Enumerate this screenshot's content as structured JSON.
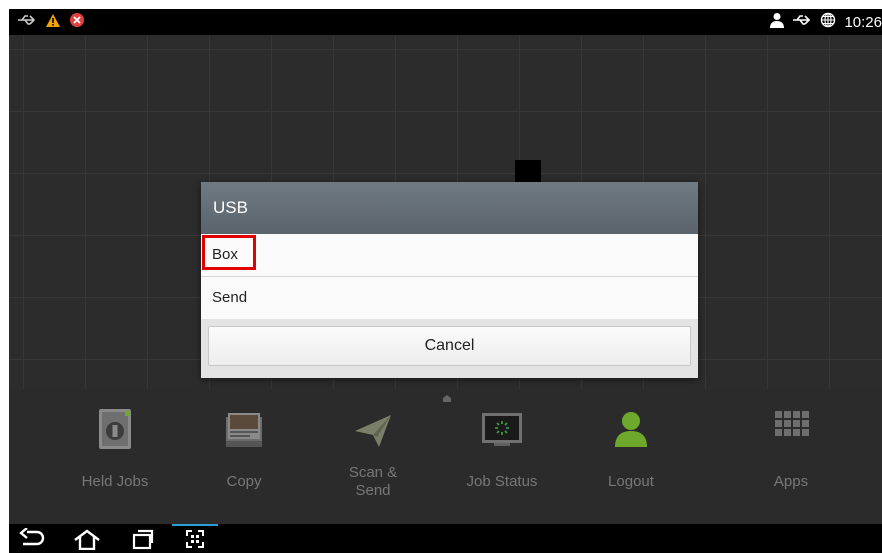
{
  "status_bar": {
    "time": "10:26",
    "left_icons": [
      "usb-icon",
      "warning-icon",
      "error-icon"
    ],
    "right_icons": [
      "user-icon",
      "usb-icon",
      "globe-icon"
    ]
  },
  "dialog": {
    "title": "USB",
    "options": [
      {
        "label": "Box",
        "highlighted": true
      },
      {
        "label": "Send",
        "highlighted": false
      }
    ],
    "cancel_label": "Cancel"
  },
  "dock": {
    "items": [
      {
        "label": "Held Jobs",
        "icon": "held-jobs-icon"
      },
      {
        "label": "Copy",
        "icon": "copy-icon"
      },
      {
        "label": "Scan &\nSend",
        "icon": "scan-send-icon"
      },
      {
        "label": "Job Status",
        "icon": "job-status-icon"
      },
      {
        "label": "Logout",
        "icon": "logout-icon"
      },
      {
        "label": "Apps",
        "icon": "apps-icon"
      }
    ]
  },
  "nav_bar": {
    "buttons": [
      "back-icon",
      "home-icon",
      "recent-apps-icon",
      "screenshot-icon"
    ]
  },
  "colors": {
    "highlight": "#e00000",
    "logout_green": "#6ea92e",
    "dialog_title_bg": "#636c74"
  }
}
